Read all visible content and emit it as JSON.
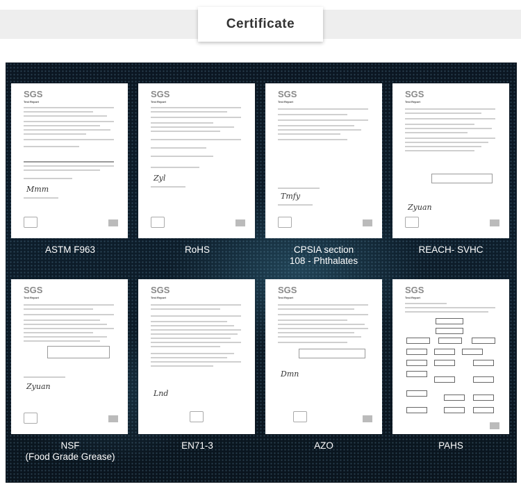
{
  "header": {
    "title": "Certificate"
  },
  "sgs_mark": "SGS",
  "report_heading": "Test Report",
  "certificates": [
    {
      "id": "astm",
      "label_line1": "ASTM F963",
      "label_line2": ""
    },
    {
      "id": "rohs",
      "label_line1": "RoHS",
      "label_line2": ""
    },
    {
      "id": "cpsia",
      "label_line1": "CPSIA section",
      "label_line2": "108 - Phthalates"
    },
    {
      "id": "reach",
      "label_line1": "REACH- SVHC",
      "label_line2": ""
    },
    {
      "id": "nsf",
      "label_line1": "NSF",
      "label_line2": "(Food Grade Grease)"
    },
    {
      "id": "en71",
      "label_line1": "EN71-3",
      "label_line2": ""
    },
    {
      "id": "azo",
      "label_line1": "AZO",
      "label_line2": ""
    },
    {
      "id": "pahs",
      "label_line1": "PAHS",
      "label_line2": ""
    }
  ],
  "colors": {
    "panel_bg": "#0b1621",
    "title_text": "#333333",
    "label_text": "#ffffff"
  }
}
